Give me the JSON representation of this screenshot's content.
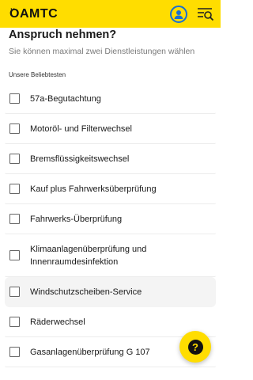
{
  "header": {
    "logo_text": "OAMTC",
    "logo_umlaut": "..",
    "profile_icon": "user-icon",
    "menu_icon": "menu-search-icon",
    "accent_color": "#ffdd00",
    "icon_color": "#1a6fd1"
  },
  "main": {
    "title": "Anspruch nehmen?",
    "subtitle": "Sie können maximal zwei Dienstleistungen wählen",
    "section_label": "Unsere Beliebtesten",
    "items": [
      {
        "label": "57a-Begutachtung",
        "checked": false
      },
      {
        "label": "Motoröl- und Filterwechsel",
        "checked": false
      },
      {
        "label": "Bremsflüssigkeitswechsel",
        "checked": false
      },
      {
        "label": "Kauf plus Fahrwerksüberprüfung",
        "checked": false
      },
      {
        "label": "Fahrwerks-Überprüfung",
        "checked": false
      },
      {
        "label": "Klimaanlagenüberprüfung und Innenraumdesinfektion",
        "checked": false
      },
      {
        "label": "Windschutzscheiben-Service",
        "checked": false
      },
      {
        "label": "Räderwechsel",
        "checked": false
      },
      {
        "label": "Gasanlagenüberprüfung G 107",
        "checked": false
      }
    ]
  },
  "fab": {
    "symbol": "?",
    "icon": "help-icon"
  }
}
